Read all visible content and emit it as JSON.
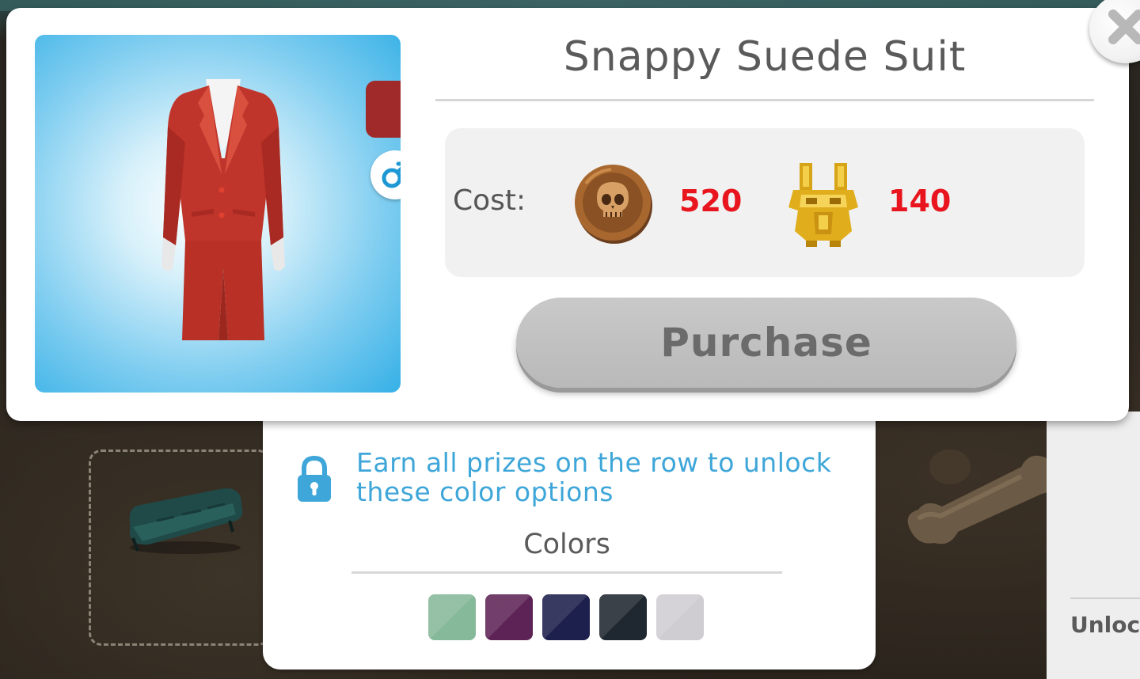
{
  "popup": {
    "title": "Snappy Suede Suit",
    "cost_label": "Cost:",
    "costs": [
      {
        "icon": "skull-coin-icon",
        "value": "520",
        "color": "#e8141e"
      },
      {
        "icon": "golden-totem-icon",
        "value": "140",
        "color": "#e8141e"
      }
    ],
    "purchase_label": "Purchase",
    "selected_color": "#a02a2a",
    "gender_icon": "male-symbol-icon",
    "close_icon": "close-icon"
  },
  "color_panel": {
    "lock_icon": "lock-icon",
    "unlock_message_line1": "Earn all prizes on the row to unlock",
    "unlock_message_line2": "these color options",
    "title": "Colors",
    "swatches": [
      "#86b89a",
      "#5e2356",
      "#1d1f4c",
      "#1f2730",
      "#cfcdd2"
    ]
  },
  "background": {
    "side_panel_text": "Unlock"
  }
}
